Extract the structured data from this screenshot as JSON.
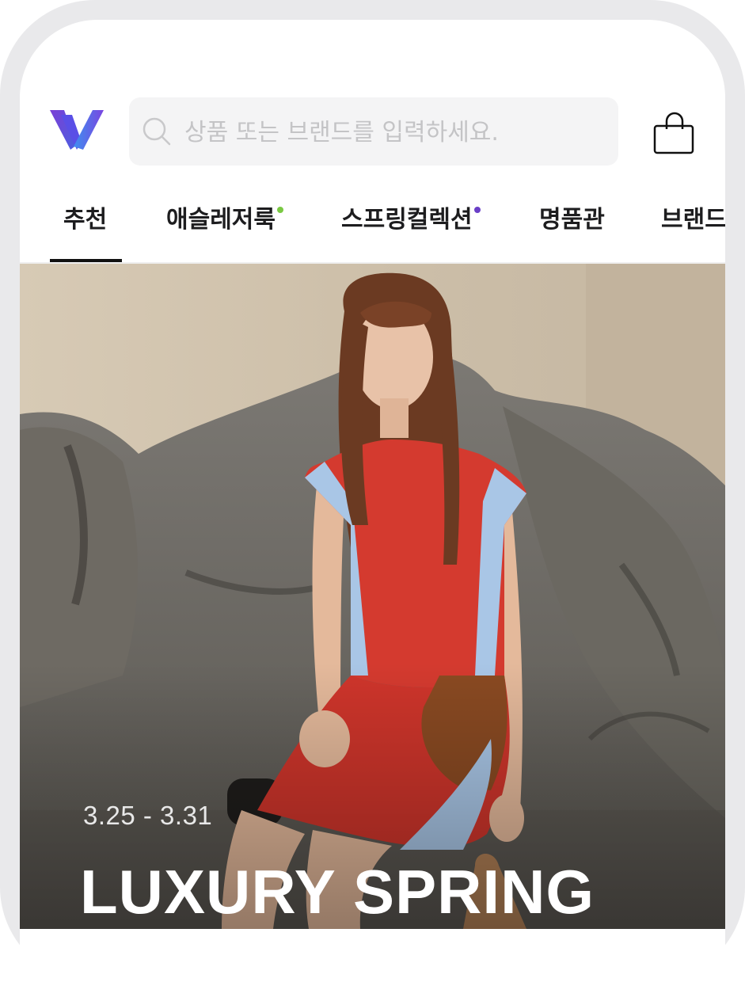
{
  "search": {
    "placeholder": "상품 또는 브랜드를 입력하세요."
  },
  "tabs": [
    {
      "label": "추천",
      "active": true,
      "dot": null
    },
    {
      "label": "애슬레저룩",
      "active": false,
      "dot": "#7ac943"
    },
    {
      "label": "스프링컬렉션",
      "active": false,
      "dot": "#6a3fc7"
    },
    {
      "label": "명품관",
      "active": false,
      "dot": null
    },
    {
      "label": "브랜드",
      "active": false,
      "dot": null
    }
  ],
  "hero": {
    "date_range": "3.25 - 3.31",
    "title": "LUXURY SPRING"
  },
  "colors": {
    "logo_gradient_start": "#6a3fc7",
    "logo_gradient_end": "#2d8cf0",
    "tab_active": "#111111",
    "athleisure_dot": "#7ac943",
    "spring_dot": "#6a3fc7"
  },
  "icons": {
    "logo": "w-logo-icon",
    "search": "search-icon",
    "cart": "shopping-bag-icon"
  }
}
